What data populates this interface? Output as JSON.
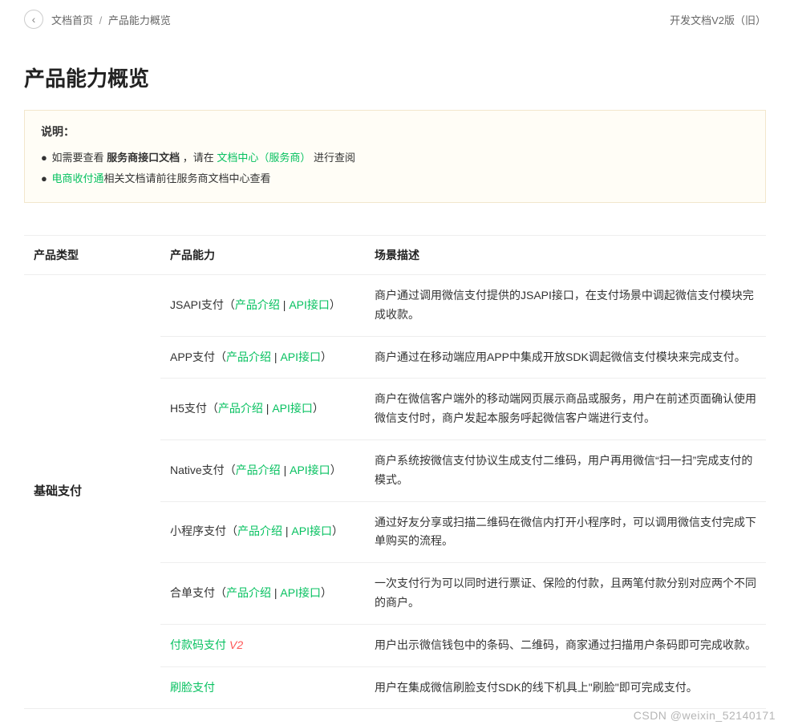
{
  "topbar": {
    "breadcrumb_home": "文档首页",
    "breadcrumb_current": "产品能力概览",
    "sep": "/",
    "version_link": "开发文档V2版（旧）"
  },
  "page_title": "产品能力概览",
  "notice": {
    "heading": "说明：",
    "line1_prefix": "如需要查看 ",
    "line1_strong": "服务商接口文档",
    "line1_mid": " ，请在 ",
    "line1_link": "文档中心（服务商）",
    "line1_suffix": " 进行查阅",
    "line2_link": "电商收付通",
    "line2_suffix": "相关文档请前往服务商文档中心查看"
  },
  "table": {
    "headers": {
      "type": "产品类型",
      "capability": "产品能力",
      "desc": "场景描述"
    },
    "category": "基础支付",
    "link_intro": "产品介绍",
    "link_api": "API接口",
    "sep": " | ",
    "paren_open": "（",
    "paren_close": "）",
    "rows": [
      {
        "name": "JSAPI支付",
        "links": true,
        "name_is_link": false,
        "v2": false,
        "desc": "商户通过调用微信支付提供的JSAPI接口，在支付场景中调起微信支付模块完成收款。"
      },
      {
        "name": "APP支付",
        "links": true,
        "name_is_link": false,
        "v2": false,
        "desc": "商户通过在移动端应用APP中集成开放SDK调起微信支付模块来完成支付。"
      },
      {
        "name": "H5支付",
        "links": true,
        "name_is_link": false,
        "v2": false,
        "desc": "商户在微信客户端外的移动端网页展示商品或服务，用户在前述页面确认使用微信支付时，商户发起本服务呼起微信客户端进行支付。"
      },
      {
        "name": "Native支付",
        "links": true,
        "name_is_link": false,
        "v2": false,
        "desc": "商户系统按微信支付协议生成支付二维码，用户再用微信“扫一扫”完成支付的模式。"
      },
      {
        "name": "小程序支付",
        "links": true,
        "name_is_link": false,
        "v2": false,
        "desc": "通过好友分享或扫描二维码在微信内打开小程序时，可以调用微信支付完成下单购买的流程。"
      },
      {
        "name": "合单支付",
        "links": true,
        "name_is_link": false,
        "v2": false,
        "desc": "一次支付行为可以同时进行票证、保险的付款，且两笔付款分别对应两个不同的商户。"
      },
      {
        "name": "付款码支付",
        "links": false,
        "name_is_link": true,
        "v2": true,
        "desc": "用户出示微信钱包中的条码、二维码，商家通过扫描用户条码即可完成收款。"
      },
      {
        "name": "刷脸支付",
        "links": false,
        "name_is_link": true,
        "v2": false,
        "desc": "用户在集成微信刷脸支付SDK的线下机具上\"刷脸\"即可完成支付。"
      }
    ]
  },
  "watermark": "CSDN @weixin_52140171"
}
